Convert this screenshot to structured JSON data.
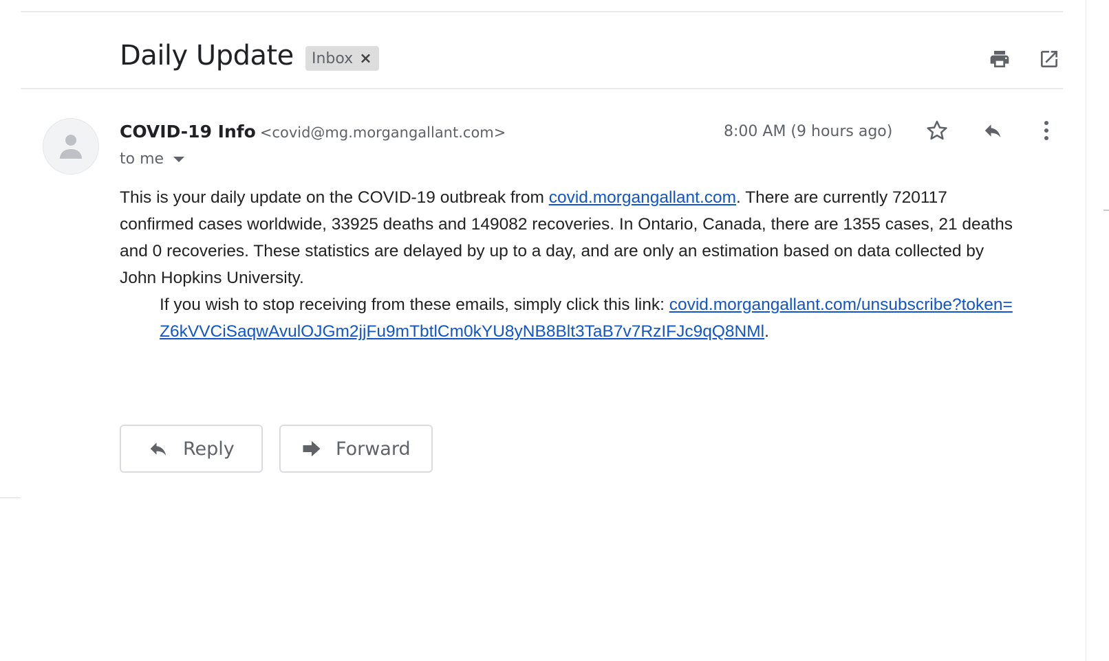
{
  "email": {
    "subject": "Daily Update",
    "label": "Inbox",
    "label_remove": "×",
    "sender_name": "COVID-19 Info",
    "sender_email": "<covid@mg.morgangallant.com>",
    "recipient": "to me",
    "timestamp": "8:00 AM (9 hours ago)",
    "body": {
      "p1_part1": "This is your daily update on the COVID-19 outbreak from ",
      "p1_link": "covid.morgangallant.com",
      "p1_part2": ". There are currently 720117 confirmed cases worldwide, 33925 deaths and 149082 recoveries. In Ontario, Canada, there are 1355 cases, 21 deaths and 0 recoveries. These statistics are delayed by up to a day, and are only an estimation based on data collected by John Hopkins University.",
      "p2_part1": "If you wish to stop receiving from these emails, simply click this link: ",
      "p2_link": "covid.morgangallant.com/unsubscribe?token=Z6kVVCiSaqwAvulOJGm2jjFu9mTbtlCm0kYU8yNB8Blt3TaB7v7RzIFJc9qQ8NMl",
      "p2_part2": "."
    }
  },
  "actions": {
    "reply_label": "Reply",
    "forward_label": "Forward"
  },
  "icons": {
    "print": "printer-icon",
    "popout": "open-in-new-window-icon",
    "star": "star-outline-icon",
    "reply": "reply-icon",
    "more": "more-vertical-icon",
    "forward": "forward-icon",
    "avatar": "default-person-icon",
    "dropdown": "caret-down-icon"
  },
  "colors": {
    "link": "#1155cc",
    "icon": "#5f6368",
    "label_chip": "#dddddd"
  }
}
